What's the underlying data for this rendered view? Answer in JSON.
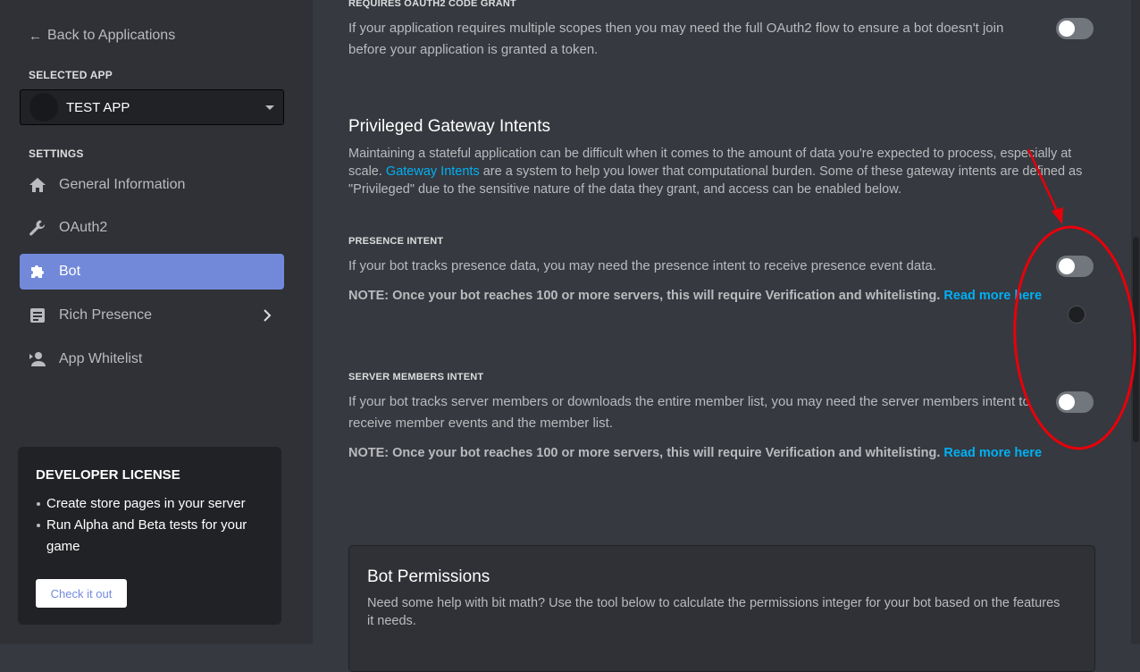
{
  "sidebar": {
    "back_label": "Back to Applications",
    "selected_app_label": "SELECTED APP",
    "app_name": "TEST APP",
    "settings_label": "SETTINGS",
    "nav": [
      {
        "label": "General Information",
        "icon": "home-icon"
      },
      {
        "label": "OAuth2",
        "icon": "wrench-icon"
      },
      {
        "label": "Bot",
        "icon": "puzzle-icon",
        "active": true
      },
      {
        "label": "Rich Presence",
        "icon": "document-icon"
      },
      {
        "label": "App Whitelist",
        "icon": "person-icon"
      }
    ],
    "license": {
      "title": "DEVELOPER LICENSE",
      "items": [
        "Create store pages in your server",
        "Run Alpha and Beta tests for your game"
      ],
      "button": "Check it out"
    }
  },
  "main": {
    "oauth": {
      "label": "REQUIRES OAUTH2 CODE GRANT",
      "line1": "If your application requires multiple scopes then you may need the full OAuth2 flow to ensure a bot doesn't join",
      "line2": "before your application is granted a token."
    },
    "gateway": {
      "title": "Privileged Gateway Intents",
      "desc_before": "Maintaining a stateful application can be difficult when it comes to the amount of data you're expected to process, especially at scale. ",
      "desc_link": "Gateway Intents",
      "desc_after": " are a system to help you lower that computational burden. Some of these gateway intents are defined as \"Privileged\" due to the sensitive nature of the data they grant, and access can be enabled below."
    },
    "presence": {
      "label": "PRESENCE INTENT",
      "desc": "If your bot tracks presence data, you may need the presence intent to receive presence event data.",
      "note": "NOTE: Once your bot reaches 100 or more servers, this will require Verification and whitelisting. ",
      "note_link": "Read more here"
    },
    "members": {
      "label": "SERVER MEMBERS INTENT",
      "line1": "If your bot tracks server members or downloads the entire member list, you may need the server members intent to",
      "line2": "receive member events and the member list.",
      "note": "NOTE: Once your bot reaches 100 or more servers, this will require Verification and whitelisting. ",
      "note_link": "Read more here"
    },
    "permissions": {
      "title": "Bot Permissions",
      "desc": "Need some help with bit math? Use the tool below to calculate the permissions integer for your bot based on the features it needs."
    }
  },
  "colors": {
    "accent": "#7289da",
    "link": "#00b0f4",
    "annotation": "#e8000b"
  }
}
